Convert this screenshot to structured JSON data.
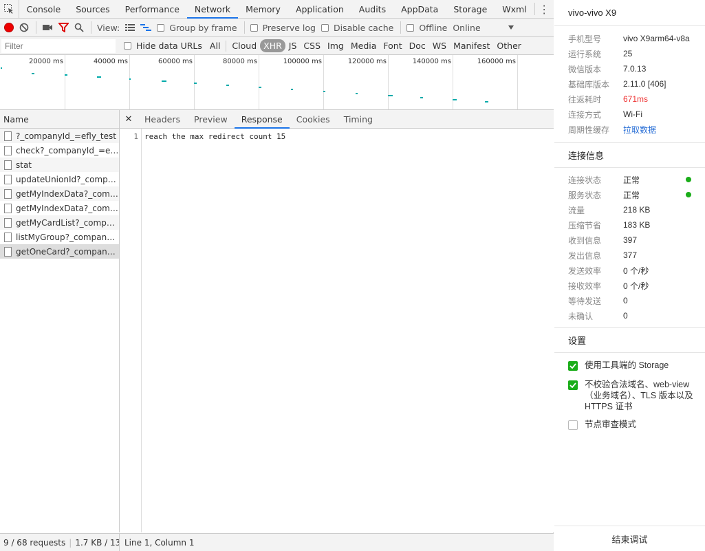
{
  "tabbar": {
    "tabs": [
      "Console",
      "Sources",
      "Performance",
      "Network",
      "Memory",
      "Application",
      "Audits",
      "AppData",
      "Storage",
      "Wxml"
    ],
    "active": "Network"
  },
  "toolbar": {
    "view_label": "View:",
    "group_by_frame": "Group by frame",
    "preserve_log": "Preserve log",
    "disable_cache": "Disable cache",
    "offline": "Offline",
    "throttle": "Online"
  },
  "filterbar": {
    "placeholder": "Filter",
    "hide_data_urls": "Hide data URLs",
    "types": [
      "All",
      "Cloud",
      "XHR",
      "JS",
      "CSS",
      "Img",
      "Media",
      "Font",
      "Doc",
      "WS",
      "Manifest",
      "Other"
    ],
    "active_type": "XHR"
  },
  "overview": {
    "ticks": [
      "20000 ms",
      "40000 ms",
      "60000 ms",
      "80000 ms",
      "100000 ms",
      "120000 ms",
      "140000 ms",
      "160000 ms"
    ]
  },
  "names": {
    "header": "Name",
    "rows": [
      "?_companyId_=efly_test",
      "check?_companyId_=efly_test",
      "stat",
      "updateUnionId?_companyId_=efly_test",
      "getMyIndexData?_companyId_=efly_test",
      "getMyIndexData?_companyId_=efly_test",
      "getMyCardList?_companyId_=efly_test",
      "listMyGroup?_companyId_=efly_test",
      "getOneCard?_companyId_=efly_test"
    ],
    "selected_index": 8
  },
  "detail": {
    "tabs": [
      "Headers",
      "Preview",
      "Response",
      "Cookies",
      "Timing"
    ],
    "active": "Response",
    "line_number": "1",
    "response_text": "reach the max redirect count 15"
  },
  "statusbar": {
    "requests": "9 / 68 requests",
    "transferred": "1.7 KB / 13...",
    "cursor": "Line 1, Column 1"
  },
  "side": {
    "device": "vivo-vivo X9",
    "info": [
      {
        "k": "手机型号",
        "v": "vivo X9arm64-v8a"
      },
      {
        "k": "运行系统",
        "v": "25"
      },
      {
        "k": "微信版本",
        "v": "7.0.13"
      },
      {
        "k": "基础库版本",
        "v": "2.11.0 [406]"
      },
      {
        "k": "往返耗时",
        "v": "671ms"
      },
      {
        "k": "连接方式",
        "v": "Wi-Fi"
      },
      {
        "k": "周期性缓存",
        "v": "拉取数据"
      }
    ],
    "conn_title": "连接信息",
    "conn": [
      {
        "k": "连接状态",
        "v": "正常"
      },
      {
        "k": "服务状态",
        "v": "正常"
      },
      {
        "k": "流量",
        "v": "218 KB"
      },
      {
        "k": "压缩节省",
        "v": "183 KB"
      },
      {
        "k": "收到信息",
        "v": "397"
      },
      {
        "k": "发出信息",
        "v": "377"
      },
      {
        "k": "发送效率",
        "v": "0 个/秒"
      },
      {
        "k": "接收效率",
        "v": "0 个/秒"
      },
      {
        "k": "等待发送",
        "v": "0"
      },
      {
        "k": "未确认",
        "v": "0"
      }
    ],
    "settings_title": "设置",
    "settings": [
      {
        "label": "使用工具端的 Storage",
        "checked": true
      },
      {
        "label": "不校验合法域名、web-view（业务域名）、TLS 版本以及 HTTPS 证书",
        "checked": true
      },
      {
        "label": "节点审查模式",
        "checked": false
      }
    ],
    "end_button": "结束调试",
    "colors": {
      "ok_dot": "#1aad19",
      "rtt": "#e33333",
      "link": "#2a6fd6"
    }
  }
}
